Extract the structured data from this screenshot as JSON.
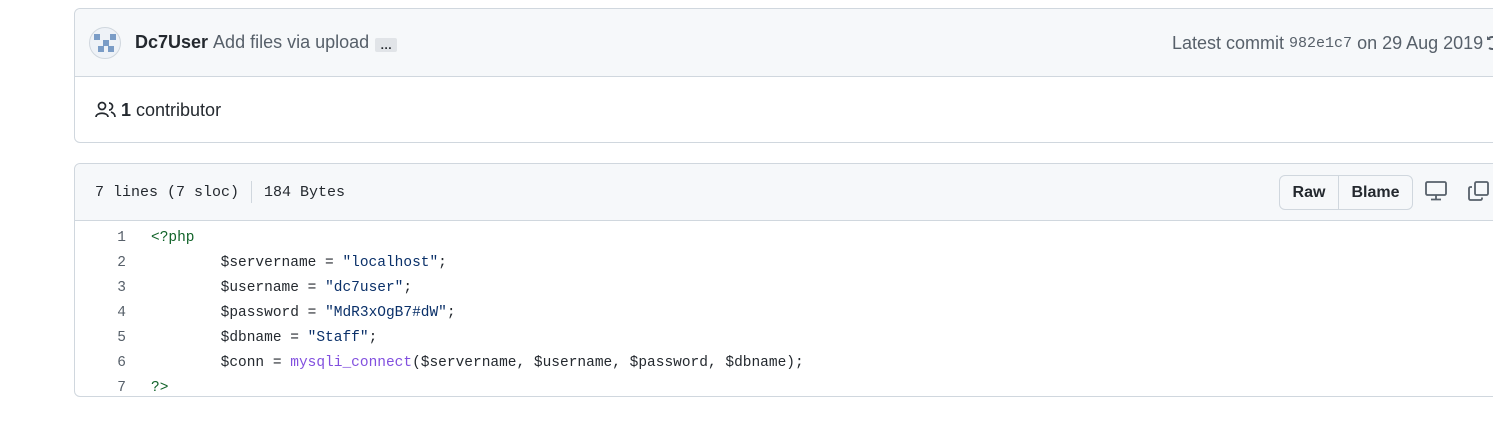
{
  "commit": {
    "author": "Dc7User",
    "message": "Add files via upload",
    "ellipsis": "…",
    "latest_prefix": "Latest commit",
    "sha": "982e1c7",
    "date": "on 29 Aug 2019"
  },
  "contributors": {
    "count": "1",
    "label": "contributor",
    "icon": "people-icon"
  },
  "file": {
    "lines_info": "7 lines (7 sloc)",
    "size": "184 Bytes",
    "raw_label": "Raw",
    "blame_label": "Blame",
    "icons": [
      "desktop-icon",
      "copy-icon"
    ]
  },
  "code": [
    {
      "n": "1",
      "indent": "",
      "tokens": [
        {
          "t": "tag",
          "v": "<?php"
        }
      ]
    },
    {
      "n": "2",
      "indent": "        ",
      "tokens": [
        {
          "t": "var",
          "v": "$servername"
        },
        {
          "t": "plain",
          "v": " = "
        },
        {
          "t": "str",
          "v": "\"localhost\""
        },
        {
          "t": "plain",
          "v": ";"
        }
      ]
    },
    {
      "n": "3",
      "indent": "        ",
      "tokens": [
        {
          "t": "var",
          "v": "$username"
        },
        {
          "t": "plain",
          "v": " = "
        },
        {
          "t": "str",
          "v": "\"dc7user\""
        },
        {
          "t": "plain",
          "v": ";"
        }
      ]
    },
    {
      "n": "4",
      "indent": "        ",
      "tokens": [
        {
          "t": "var",
          "v": "$password"
        },
        {
          "t": "plain",
          "v": " = "
        },
        {
          "t": "str",
          "v": "\"MdR3xOgB7#dW\""
        },
        {
          "t": "plain",
          "v": ";"
        }
      ]
    },
    {
      "n": "5",
      "indent": "        ",
      "tokens": [
        {
          "t": "var",
          "v": "$dbname"
        },
        {
          "t": "plain",
          "v": " = "
        },
        {
          "t": "str",
          "v": "\"Staff\""
        },
        {
          "t": "plain",
          "v": ";"
        }
      ]
    },
    {
      "n": "6",
      "indent": "        ",
      "tokens": [
        {
          "t": "var",
          "v": "$conn"
        },
        {
          "t": "plain",
          "v": " = "
        },
        {
          "t": "fn",
          "v": "mysqli_connect"
        },
        {
          "t": "plain",
          "v": "("
        },
        {
          "t": "var",
          "v": "$servername"
        },
        {
          "t": "plain",
          "v": ", "
        },
        {
          "t": "var",
          "v": "$username"
        },
        {
          "t": "plain",
          "v": ", "
        },
        {
          "t": "var",
          "v": "$password"
        },
        {
          "t": "plain",
          "v": ", "
        },
        {
          "t": "var",
          "v": "$dbname"
        },
        {
          "t": "plain",
          "v": ");"
        }
      ]
    },
    {
      "n": "7",
      "indent": "",
      "tokens": [
        {
          "t": "tag",
          "v": "?>"
        }
      ]
    }
  ],
  "colors": {
    "border": "#d0d7de",
    "header_bg": "#f6f8fa",
    "muted": "#57606a",
    "string": "#0a3069",
    "function": "#8250df",
    "php_tag": "#116329"
  }
}
